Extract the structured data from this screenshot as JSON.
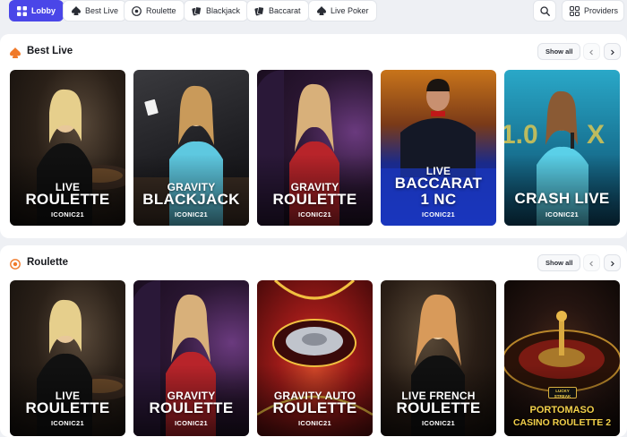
{
  "nav": {
    "tabs": [
      {
        "label": "Lobby",
        "icon": "grid-icon",
        "active": true
      },
      {
        "label": "Best Live",
        "icon": "spade-icon"
      },
      {
        "label": "Roulette",
        "icon": "roulette-icon"
      },
      {
        "label": "Blackjack",
        "icon": "cards-icon"
      },
      {
        "label": "Baccarat",
        "icon": "cards-icon"
      },
      {
        "label": "Live Poker",
        "icon": "spade-icon"
      }
    ],
    "search_icon": "search-icon",
    "providers_label": "Providers"
  },
  "sections": [
    {
      "title": "Best Live",
      "icon": "spade-icon",
      "show_all": "Show all",
      "games": [
        {
          "line1": "LIVE",
          "line2": "ROULETTE",
          "provider": "ICONIC21",
          "theme": "dark"
        },
        {
          "line1": "GRAVITY",
          "line2": "BLACKJACK",
          "provider": "ICONIC21",
          "theme": "dark"
        },
        {
          "line1": "GRAVITY",
          "line2": "ROULETTE",
          "provider": "ICONIC21",
          "theme": "purple"
        },
        {
          "line1": "LIVE",
          "line2": "BACCARAT",
          "line3": "1 NC",
          "provider": "ICONIC21",
          "theme": "blue"
        },
        {
          "line1": "",
          "line2": "CRASH LIVE",
          "provider": "ICONIC21",
          "theme": "cyan"
        }
      ]
    },
    {
      "title": "Roulette",
      "icon": "roulette-icon",
      "show_all": "Show all",
      "games": [
        {
          "line1": "LIVE",
          "line2": "ROULETTE",
          "provider": "ICONIC21",
          "theme": "dark"
        },
        {
          "line1": "GRAVITY",
          "line2": "ROULETTE",
          "provider": "ICONIC21",
          "theme": "purple"
        },
        {
          "line1": "GRAVITY AUTO",
          "line2": "ROULETTE",
          "provider": "ICONIC21",
          "theme": "red"
        },
        {
          "line1": "LIVE FRENCH",
          "line2": "ROULETTE",
          "provider": "ICONIC21",
          "theme": "dark"
        },
        {
          "line1": "PORTOMASO",
          "line2": "CASINO ROULETTE 2",
          "badge": "LUCKY STREAK",
          "provider": "",
          "theme": "wheel"
        }
      ]
    }
  ],
  "colors": {
    "accent": "#4a46e8",
    "section_icon": "#f07a2a"
  }
}
